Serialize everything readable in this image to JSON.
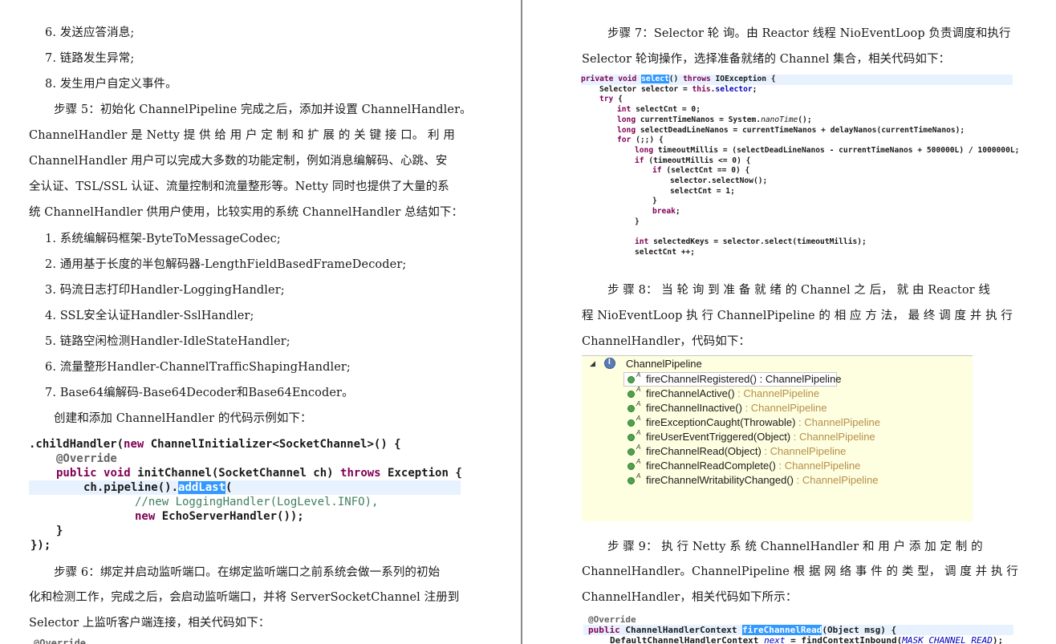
{
  "left": {
    "list_top": [
      "6. 发送应答消息;",
      "7. 链路发生异常;",
      "8. 发生用户自定义事件。"
    ],
    "para5": [
      "步骤 5：初始化 ChannelPipeline 完成之后，添加并设置 ChannelHandler。",
      "ChannelHandler 是 Netty 提 供 给 用 户 定 制 和 扩 展 的 关 键 接 口。 利 用",
      "ChannelHandler 用户可以完成大多数的功能定制，例如消息编解码、心跳、安",
      "全认证、TSL/SSL 认证、流量控制和流量整形等。Netty 同时也提供了大量的系",
      "统 ChannelHandler 供用户使用，比较实用的系统 ChannelHandler 总结如下："
    ],
    "handler_list": [
      "1. 系统编解码框架-ByteToMessageCodec;",
      "2. 通用基于长度的半包解码器-LengthFieldBasedFrameDecoder;",
      "3. 码流日志打印Handler-LoggingHandler;",
      "4. SSL安全认证Handler-SslHandler;",
      "5. 链路空闲检测Handler-IdleStateHandler;",
      "6. 流量整形Handler-ChannelTrafficShapingHandler;",
      "7. Base64编解码-Base64Decoder和Base64Encoder。"
    ],
    "create_intro": "创建和添加 ChannelHandler 的代码示例如下：",
    "code1": {
      "l1a": ".childHandler(",
      "l1kw": "new",
      "l1b": " ChannelInitializer<SocketChannel>() {",
      "l2": "@Override",
      "l3kw1": "public",
      "l3kw2": "void",
      "l3a": " initChannel(SocketChannel ch) ",
      "l3kw3": "throws",
      "l3b": " Exception {",
      "l4a": "ch.pipeline().",
      "l4hl": "addLast",
      "l4b": "(",
      "l5": "//new LoggingHandler(LogLevel.INFO),",
      "l6kw": "new",
      "l6b": " EchoServerHandler());",
      "l7": "}",
      "l8": "});"
    },
    "para6": [
      "步骤 6：绑定并启动监听端口。在绑定监听端口之前系统会做一系列的初始",
      "化和检测工作，完成之后，会启动监听端口，并将 ServerSocketChannel 注册到",
      "Selector 上监听客户端连接，相关代码如下："
    ],
    "code_bottom": "@Override"
  },
  "right": {
    "para7": [
      "步骤 7：Selector 轮 询。由 Reactor 线程 NioEventLoop 负责调度和执行",
      "Selector 轮询操作，选择准备就绪的 Channel 集合，相关代码如下："
    ],
    "code2": {
      "l1kw1": "private",
      "l1kw2": "void",
      "l1hl": "select",
      "l1a": "() ",
      "l1kw3": "throws",
      "l1b": " IOException {",
      "l2a": "Selector selector = ",
      "l2kw": "this",
      "l2b": ".",
      "l2fld": "selector",
      "l2c": ";",
      "l3kw": "try",
      "l3b": " {",
      "l4kw": "int",
      "l4b": " selectCnt = 0;",
      "l5kw": "long",
      "l5a": " currentTimeNanos = System.",
      "l5it": "nanoTime",
      "l5b": "();",
      "l6kw": "long",
      "l6b": " selectDeadLineNanos = currentTimeNanos + delayNanos(currentTimeNanos);",
      "l7kw": "for",
      "l7b": " (;;) {",
      "l8kw": "long",
      "l8b": " timeoutMillis = (selectDeadLineNanos - currentTimeNanos + 500000L) / 1000000L;",
      "l9kw": "if",
      "l9b": " (timeoutMillis <= 0) {",
      "l10kw": "if",
      "l10b": " (selectCnt == 0) {",
      "l11": "selector.selectNow();",
      "l12": "selectCnt = 1;",
      "l13": "}",
      "l14kw": "break",
      "l14b": ";",
      "l15": "}",
      "l16kw": "int",
      "l16b": " selectedKeys = selector.select(timeoutMillis);",
      "l17": "selectCnt ++;"
    },
    "para8": [
      "步 骤 8： 当 轮 询 到 准 备 就 绪 的 Channel 之 后， 就 由 Reactor 线",
      "程 NioEventLoop 执 行 ChannelPipeline 的 相 应 方 法， 最 终 调 度 并 执 行",
      "ChannelHandler，代码如下："
    ],
    "outline": {
      "root": "ChannelPipeline",
      "methods": [
        {
          "name": "fireChannelRegistered()",
          "ret": " : ChannelPipeline"
        },
        {
          "name": "fireChannelActive()",
          "ret": " : ChannelPipeline"
        },
        {
          "name": "fireChannelInactive()",
          "ret": " : ChannelPipeline"
        },
        {
          "name": "fireExceptionCaught(Throwable)",
          "ret": " : ChannelPipeline"
        },
        {
          "name": "fireUserEventTriggered(Object)",
          "ret": " : ChannelPipeline"
        },
        {
          "name": "fireChannelRead(Object)",
          "ret": " : ChannelPipeline"
        },
        {
          "name": "fireChannelReadComplete()",
          "ret": " : ChannelPipeline"
        },
        {
          "name": "fireChannelWritabilityChanged()",
          "ret": " : ChannelPipeline"
        }
      ],
      "modifier": "A"
    },
    "para9": [
      "步 骤 9： 执 行 Netty 系 统 ChannelHandler 和 用 户 添 加 定 制 的",
      "ChannelHandler。ChannelPipeline 根 据 网 络 事 件 的 类 型， 调 度 并 执 行",
      "ChannelHandler，相关代码如下所示："
    ],
    "code3": {
      "l1": "@Override",
      "l2kw": "public",
      "l2a": " ChannelHandlerContext ",
      "l2hl": "fireChannelRead",
      "l2b": "(Object msg) {",
      "l3a": "DefaultChannelHandlerContext ",
      "l3it": "next",
      "l3b": " = findContextInbound(",
      "l3it2": "MASK_CHANNEL_READ",
      "l3c": ");"
    }
  }
}
